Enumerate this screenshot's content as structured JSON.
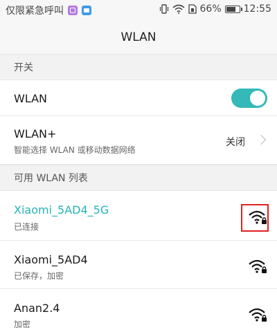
{
  "status_bar": {
    "carrier_text": "仅限紧急呼叫",
    "battery_percent": "66%",
    "time": "12:55",
    "icons": [
      "app-badge-icon",
      "app-badge-icon",
      "vibrate-icon",
      "wifi-signal-icon",
      "sim-icon",
      "battery-icon"
    ]
  },
  "header": {
    "title": "WLAN"
  },
  "sections": {
    "switch_header": "开关",
    "available_header": "可用 WLAN 列表"
  },
  "wlan_toggle": {
    "label": "WLAN",
    "on": true
  },
  "wlan_plus": {
    "label": "WLAN+",
    "description": "智能选择 WLAN 或移动数据网络",
    "value": "关闭"
  },
  "networks": [
    {
      "ssid": "Xiaomi_5AD4_5G",
      "status": "已连接",
      "connected": true,
      "icon": "wifi-lock-icon"
    },
    {
      "ssid": "Xiaomi_5AD4",
      "status": "已保存，加密",
      "connected": false,
      "icon": "wifi-lock-icon"
    },
    {
      "ssid": "Anan2.4",
      "status": "加密",
      "connected": false,
      "icon": "wifi-lock-icon"
    }
  ],
  "colors": {
    "accent": "#26b3b6",
    "toggle_on": "#35b8b8",
    "highlight": "#e02020"
  }
}
